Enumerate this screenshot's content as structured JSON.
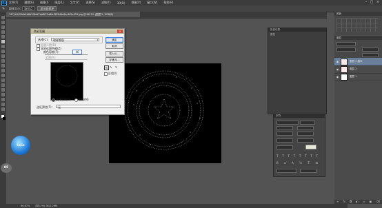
{
  "menubar": {
    "logo": "Ps",
    "items": [
      "文件(F)",
      "编辑(E)",
      "图像(I)",
      "图层(L)",
      "文字(Y)",
      "选择(S)",
      "滤镜(T)",
      "3D(D)",
      "视图(V)",
      "窗口(W)",
      "帮助(H)"
    ]
  },
  "options": {
    "tool_preset": "取样大小:",
    "sample_value": "取样点",
    "show_sampling": "显示取样环"
  },
  "document": {
    "tab_title": "1471b2f93da4b8d1f6ad7ab8f72a8fe3f59d6a9b-602x451.jpg @ 66.7% (图层 2, RGB/8)"
  },
  "status": {
    "zoom": "66.67%",
    "doc_size": "文档:795.3K/2.26M"
  },
  "dialog": {
    "title": "色彩范围",
    "select_label": "选择(C):",
    "select_value": "取样颜色",
    "detect_faces": "检测人脸(D)",
    "localized": "本地化颜色簇(Z)",
    "fuzziness_label": "颜色容差(F):",
    "fuzziness_value": "40",
    "range_label": "范围(R):",
    "selection_radio": "选择范围(E)",
    "image_radio": "图像(M)",
    "preview_label": "选区预览(T):",
    "preview_value": "无",
    "buttons": [
      "确定",
      "取消",
      "载入(L)...",
      "存储(S)..."
    ],
    "invert": "反相(I)"
  },
  "panels": {
    "history_title": "历史记录",
    "properties_title": "属性",
    "right_tabs": [
      "颜色",
      "色板",
      "调整",
      "样式"
    ],
    "layers_tabs": [
      "图层",
      "通道",
      "路径"
    ],
    "layers": [
      {
        "name": "图层 2 副本",
        "selected": true
      },
      {
        "name": "图层 2",
        "selected": false
      },
      {
        "name": "图层 1",
        "selected": false
      }
    ],
    "character_title": "字符"
  },
  "badge": {
    "text": "CoCo",
    "zoom_number": "85"
  },
  "colors": {
    "accent": "#3aa0e8",
    "selected_layer": "#6a7f9a"
  }
}
